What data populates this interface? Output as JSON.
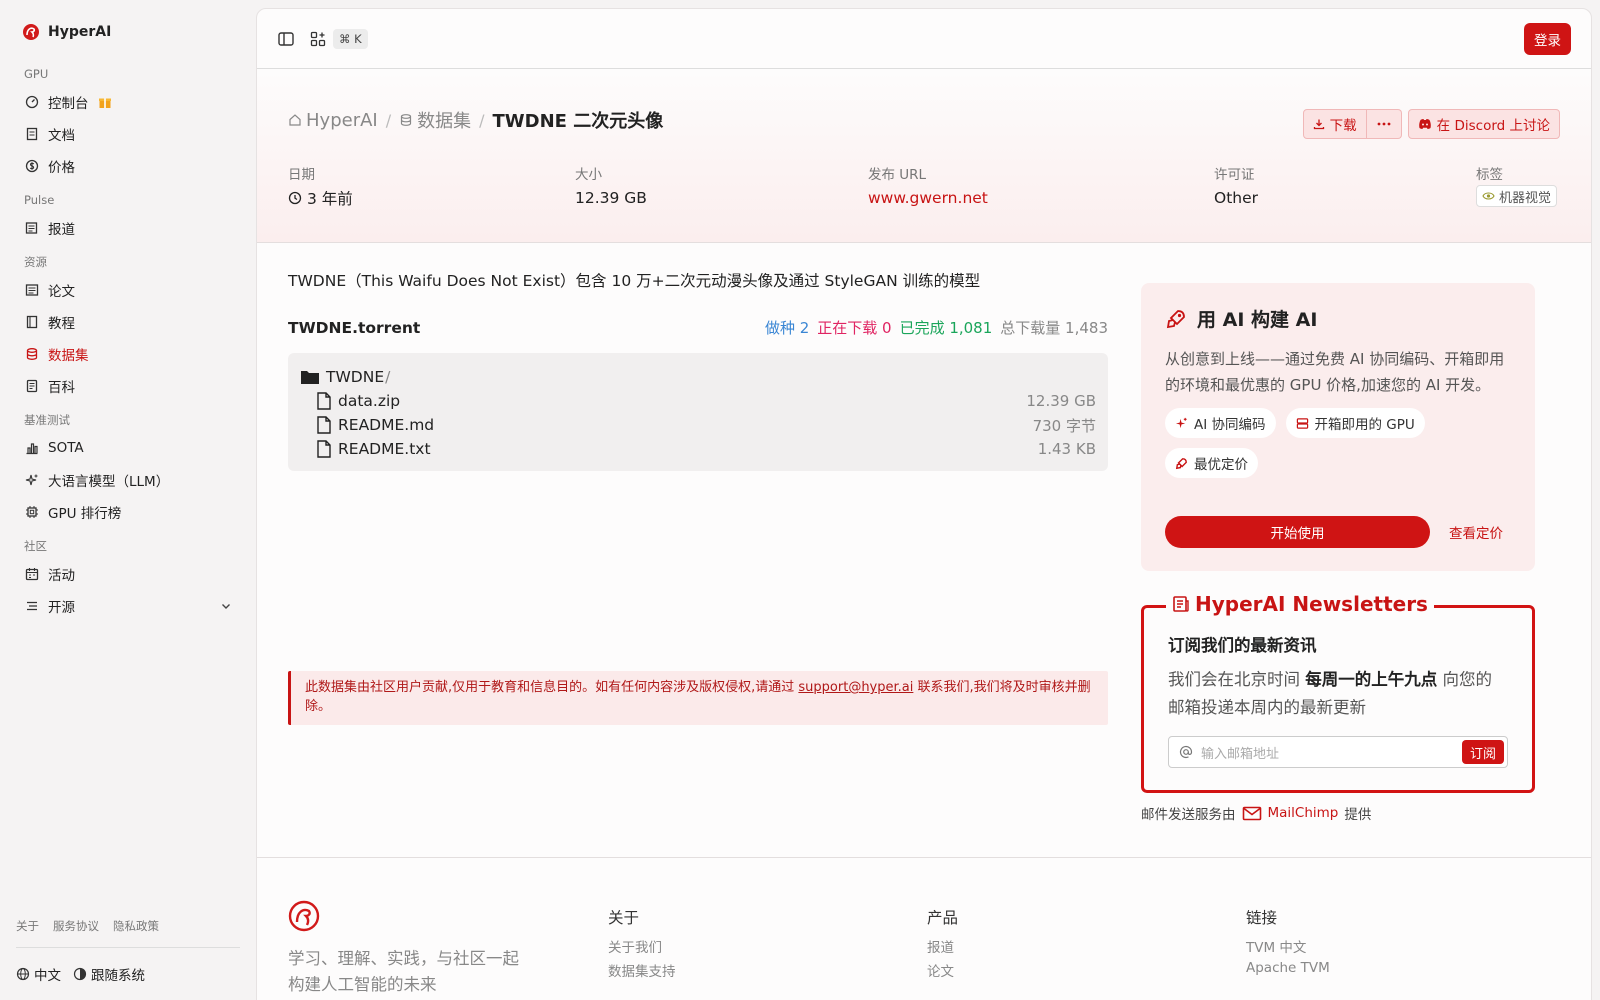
{
  "app": {
    "name": "HyperAI"
  },
  "sidebar": {
    "sections": [
      {
        "title": "GPU",
        "items": [
          {
            "label": "控制台",
            "icon": "dashboard-icon"
          },
          {
            "label": "文档",
            "icon": "doc-icon"
          },
          {
            "label": "价格",
            "icon": "dollar-icon"
          }
        ]
      },
      {
        "title": "Pulse",
        "items": [
          {
            "label": "报道",
            "icon": "news-icon"
          }
        ]
      },
      {
        "title": "资源",
        "items": [
          {
            "label": "论文",
            "icon": "paper-icon"
          },
          {
            "label": "教程",
            "icon": "book-icon"
          },
          {
            "label": "数据集",
            "icon": "database-icon"
          },
          {
            "label": "百科",
            "icon": "wiki-icon"
          }
        ]
      },
      {
        "title": "基准测试",
        "items": [
          {
            "label": "SOTA",
            "icon": "chart-icon"
          },
          {
            "label": "大语言模型（LLM）",
            "icon": "sparkle-icon"
          },
          {
            "label": "GPU 排行榜",
            "icon": "chip-icon"
          }
        ]
      },
      {
        "title": "社区",
        "items": [
          {
            "label": "活动",
            "icon": "calendar-icon"
          },
          {
            "label": "开源",
            "icon": "list-icon"
          }
        ]
      }
    ],
    "footer_links": [
      "关于",
      "服务协议",
      "隐私政策"
    ],
    "language": "中文",
    "theme": "跟随系统"
  },
  "topbar": {
    "shortcut": "⌘ K",
    "login": "登录"
  },
  "breadcrumb": {
    "home": "HyperAI",
    "section": "数据集",
    "current": "TWDNE 二次元头像"
  },
  "actions": {
    "download": "下载",
    "discord": "在 Discord 上讨论"
  },
  "meta": {
    "date_label": "日期",
    "date_value": "3 年前",
    "size_label": "大小",
    "size_value": "12.39 GB",
    "url_label": "发布 URL",
    "url_value": "www.gwern.net",
    "license_label": "许可证",
    "license_value": "Other",
    "tags_label": "标签",
    "tag_value": "机器视觉"
  },
  "description": "TWDNE（This Waifu Does Not Exist）包含 10 万+二次元动漫头像及通过 StyleGAN 训练的模型",
  "torrent": {
    "name": "TWDNE.torrent",
    "seeding": "做种 2",
    "downloading": "正在下载 0",
    "completed": "已完成 1,081",
    "total": "总下载量 1,483",
    "folder": "TWDNE",
    "files": [
      {
        "name": "data.zip",
        "size": "12.39 GB"
      },
      {
        "name": "README.md",
        "size": "730 字节"
      },
      {
        "name": "README.txt",
        "size": "1.43 KB"
      }
    ]
  },
  "notice": {
    "text_before": "此数据集由社区用户贡献,仅用于教育和信息目的。如有任何内容涉及版权侵权,请通过",
    "email": "support@hyper.ai",
    "text_after": "联系我们,我们将及时审核并删除。"
  },
  "promo": {
    "title": "用 AI 构建 AI",
    "desc": "从创意到上线——通过免费 AI 协同编码、开箱即用的环境和最优惠的 GPU 价格,加速您的 AI 开发。",
    "chips": [
      "AI 协同编码",
      "开箱即用的 GPU",
      "最优定价"
    ],
    "start": "开始使用",
    "pricing": "查看定价"
  },
  "newsletter": {
    "title": "HyperAI Newsletters",
    "heading": "订阅我们的最新资讯",
    "text_before": "我们会在北京时间",
    "text_bold": "每周一的上午九点",
    "text_after": "向您的邮箱投递本周内的最新更新",
    "placeholder": "输入邮箱地址",
    "subscribe": "订阅",
    "mail_note_before": "邮件发送服务由",
    "mail_provider": "MailChimp",
    "mail_note_after": "提供"
  },
  "footer": {
    "tagline": "学习、理解、实践，与社区一起构建人工智能的未来",
    "cols": [
      {
        "title": "关于",
        "links": [
          "关于我们",
          "数据集支持"
        ]
      },
      {
        "title": "产品",
        "links": [
          "报道",
          "论文"
        ]
      },
      {
        "title": "链接",
        "links": [
          "TVM 中文",
          "Apache TVM"
        ]
      }
    ]
  },
  "colors": {
    "accent": "#cf1414",
    "sidebar_bg": "#f5f3f3",
    "panel_bg": "#fdfcfc"
  }
}
